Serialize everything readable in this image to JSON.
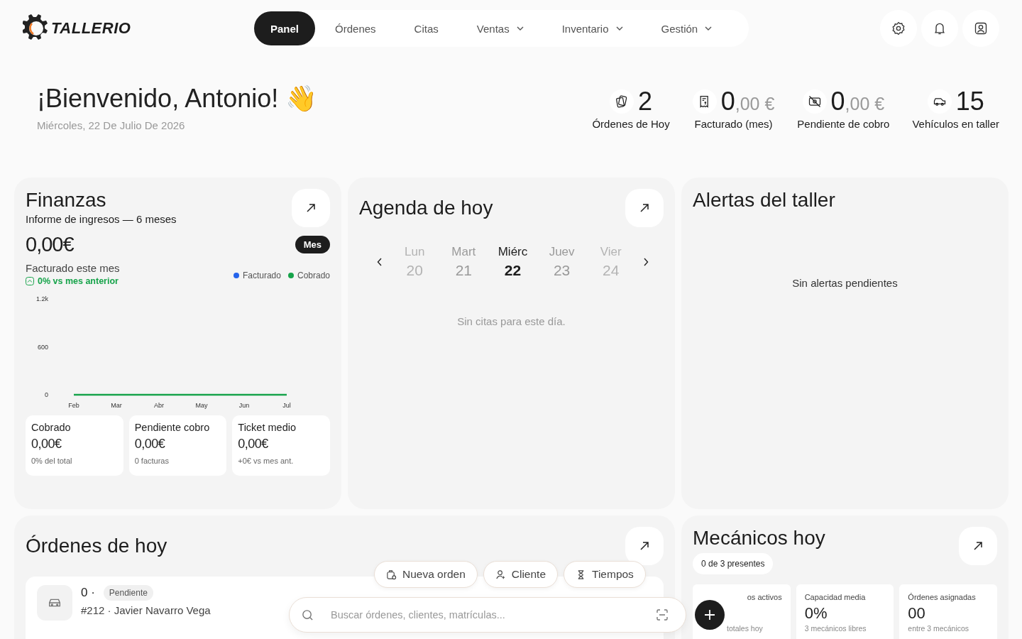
{
  "brand": {
    "name": "TALLERIO"
  },
  "nav": [
    {
      "label": "Panel",
      "selected": true,
      "dropdown": false
    },
    {
      "label": "Órdenes",
      "selected": false,
      "dropdown": false
    },
    {
      "label": "Citas",
      "selected": false,
      "dropdown": false
    },
    {
      "label": "Ventas",
      "selected": false,
      "dropdown": true
    },
    {
      "label": "Inventario",
      "selected": false,
      "dropdown": true
    },
    {
      "label": "Gestión",
      "selected": false,
      "dropdown": true
    }
  ],
  "welcome": {
    "title": "¡Bienvenido, Antonio! 👋",
    "date": "Miércoles, 22 De Julio De 2026"
  },
  "stats": [
    {
      "kind": "orders",
      "value": "2",
      "label": "Órdenes de Hoy"
    },
    {
      "kind": "receipt",
      "value": "0",
      "decimals": ",00 €",
      "label": "Facturado (mes)"
    },
    {
      "kind": "pending",
      "value": "0",
      "decimals": ",00 €",
      "label": "Pendiente de cobro"
    },
    {
      "kind": "vehicle",
      "value": "15",
      "label": "Vehículos en taller"
    }
  ],
  "finanzas": {
    "title": "Finanzas",
    "subtitle": "Informe de ingresos — 6 meses",
    "amount": "0,00€",
    "period": "Mes",
    "amount_label": "Facturado este mes",
    "trend": "0% vs mes anterior",
    "chart_data": {
      "type": "line",
      "categories": [
        "Feb",
        "Mar",
        "Abr",
        "May",
        "Jun",
        "Jul"
      ],
      "ylim": [
        0,
        1200
      ],
      "yticks": [
        0,
        600,
        {
          "value": 1200,
          "label": "1.2k"
        }
      ],
      "series": [
        {
          "name": "Facturado",
          "color": "#2563eb",
          "values": [
            null,
            null,
            null,
            null,
            null,
            null
          ]
        },
        {
          "name": "Cobrado",
          "color": "#16a34a",
          "values": [
            0,
            0,
            0,
            0,
            0,
            0
          ]
        }
      ]
    },
    "tiles": [
      {
        "title": "Cobrado",
        "value": "0,00€",
        "note": "0% del total"
      },
      {
        "title": "Pendiente cobro",
        "value": "0,00€",
        "note": "0 facturas"
      },
      {
        "title": "Ticket medio",
        "value": "0,00€",
        "note": "+0€ vs mes ant."
      }
    ]
  },
  "agenda": {
    "title": "Agenda de hoy",
    "days": [
      {
        "name": "Lun",
        "number": "20",
        "selected": false
      },
      {
        "name": "Mart",
        "number": "21",
        "selected": false
      },
      {
        "name": "Miérc",
        "number": "22",
        "selected": true
      },
      {
        "name": "Juev",
        "number": "23",
        "selected": false
      },
      {
        "name": "Vier",
        "number": "24",
        "selected": false
      }
    ],
    "empty": "Sin citas para este día."
  },
  "alertas": {
    "title": "Alertas del taller",
    "empty": "Sin alertas pendientes"
  },
  "ordenes": {
    "title": "Órdenes de hoy",
    "rows": [
      {
        "number": "0 ·",
        "status": "Pendiente",
        "detail": "#212 · Javier Navarro Vega"
      }
    ]
  },
  "mecanicos": {
    "title": "Mecánicos hoy",
    "badge": "0 de 3 presentes",
    "tiles": [
      {
        "title": "os activos",
        "note": "totales hoy"
      },
      {
        "title": "Capacidad media",
        "value": "0%",
        "note": "3 mecánicos libres"
      },
      {
        "title": "Órdenes asignadas",
        "value": "00",
        "note": "entre 3 mecánicos"
      }
    ]
  },
  "quick_actions": [
    {
      "kind": "order",
      "label": "Nueva orden"
    },
    {
      "kind": "client",
      "label": "Cliente"
    },
    {
      "kind": "time",
      "label": "Tiempos"
    }
  ],
  "search": {
    "placeholder": "Buscar órdenes, clientes, matrículas..."
  }
}
